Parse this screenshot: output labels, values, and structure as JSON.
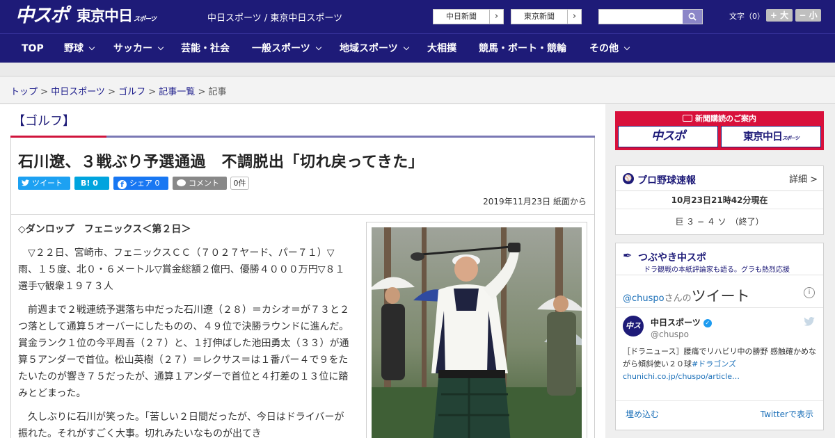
{
  "header": {
    "logo_chuspo": "中スポ",
    "logo_tokyo": "東京中日",
    "logo_tokyo_small": "スポーツ",
    "site_name": "中日スポーツ / 東京中日スポーツ",
    "link_chunichi": "中日新聞",
    "link_tokyo": "東京新聞",
    "font_size_label": "文字（0）",
    "font_up": "+ 大",
    "font_down": "− 小"
  },
  "nav": [
    {
      "label": "TOP",
      "dropdown": false
    },
    {
      "label": "野球",
      "dropdown": true
    },
    {
      "label": "サッカー",
      "dropdown": true
    },
    {
      "label": "芸能・社会",
      "dropdown": false
    },
    {
      "label": "一般スポーツ",
      "dropdown": true
    },
    {
      "label": "地域スポーツ",
      "dropdown": true
    },
    {
      "label": "大相撲",
      "dropdown": false
    },
    {
      "label": "競馬・ボート・競輪",
      "dropdown": false
    },
    {
      "label": "その他",
      "dropdown": true
    }
  ],
  "breadcrumb": {
    "items": [
      "トップ",
      "中日スポーツ",
      "ゴルフ",
      "記事一覧"
    ],
    "current": "記事",
    "sep": " > "
  },
  "article": {
    "category": "【ゴルフ】",
    "title": "石川遼、３戦ぶり予選通過　不調脱出「切れ戻ってきた」",
    "share": {
      "tweet": "ツイート",
      "hatena": "B! 0",
      "facebook": "シェア 0",
      "comment": "コメント",
      "comment_count": "0件"
    },
    "date": "2019年11月23日 紙面から",
    "heading": "◇ダンロップ　フェニックス＜第２日＞",
    "paragraphs": [
      "▽２２日、宮崎市、フェニックスＣＣ（７０２７ヤード、パー７１）▽雨、１５度、北０・６メートル▽賞金総額２億円、優勝４０００万円▽８１選手▽観衆１９７３人",
      "前週まで２戦連続予選落ち中だった石川遼（２８）＝カシオ＝が７３と２つ落として通算５オーバーにしたものの、４９位で決勝ラウンドに進んだ。賞金ランク１位の今平周吾（２７）と、１打伸ばした池田勇太（３３）が通算５アンダーで首位。松山英樹（２７）＝レクサス＝は１番パー４で９をたたいたのが響き７５だったが、通算１アンダーで首位と４打差の１３位に踏みとどまった。",
      "久しぶりに石川が笑った。「苦しい２日間だったが、今日はドライバーが振れた。それがすごく大事。切れみたいなものが出てき"
    ]
  },
  "sidebar": {
    "subscribe": {
      "title": "新聞購読のご案内",
      "btn1": "中スポ",
      "btn2": "東京中日",
      "btn2_small": "スポーツ"
    },
    "baseball": {
      "title": "プロ野球速報",
      "more": "詳細 >",
      "updated": "10月23日21時42分現在",
      "score": "巨 ３ − ４ ソ　（終了）"
    },
    "twitter": {
      "title": "つぶやき中スポ",
      "subtitle": "ドラ観戦の本紙評論家も語る。グラも熱烈応援",
      "handle": "@chuspo",
      "handle_suffix": "さんの",
      "tweets_word": "ツイート",
      "avatar": "中スポ",
      "account_name": "中日スポーツ",
      "screen_name": "@chuspo",
      "tweet_text": "［ドラニュース］腰痛でリハビリ中の勝野 感触確かめながら傾斜使い２０球",
      "tweet_hashtag": "#ドラゴンズ",
      "tweet_link": "chunichi.co.jp/chuspo/article…",
      "embed": "埋め込む",
      "view": "Twitterで表示"
    }
  },
  "colors": {
    "brand_navy": "#1e1b78",
    "accent_red": "#d0143c",
    "twitter_blue": "#1da1f2",
    "hatena_blue": "#00a4de",
    "facebook_blue": "#1877f2",
    "comment_gray": "#888888"
  }
}
